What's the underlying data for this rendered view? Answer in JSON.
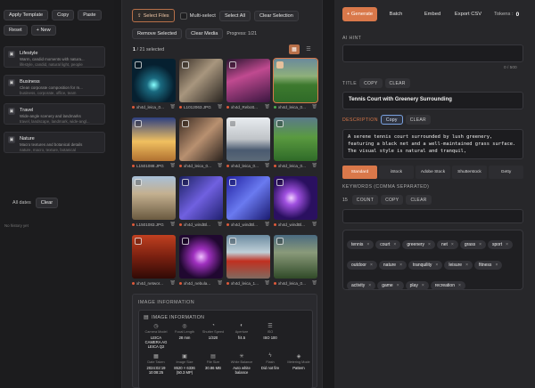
{
  "left": {
    "buttons": [
      "Apply Template",
      "Copy",
      "Paste"
    ],
    "row2": [
      "Reset",
      "+ New"
    ],
    "templates": [
      {
        "icon": "▣",
        "title": "Lifestyle",
        "sub": "Warm, candid moments with natura...",
        "tags": "lifestyle, candid, natural light, people"
      },
      {
        "icon": "▣",
        "title": "Business",
        "sub": "Clean corporate composition for m...",
        "tags": "business, corporate, office, team"
      },
      {
        "icon": "▣",
        "title": "Travel",
        "sub": "Wide-angle scenery and landmarks",
        "tags": "travel, landscape, landmark, wide-angl..."
      },
      {
        "icon": "▣",
        "title": "Nature",
        "sub": "Macro textures and botanical details",
        "tags": "nature, macro, texture, botanical"
      }
    ],
    "history_select": "All dates",
    "history_clear": "Clear",
    "no_history": "No history yet"
  },
  "middle": {
    "select_files": "Select Files",
    "multi_select": "Multi-select",
    "select_all": "Select All",
    "clear_selection": "Clear Selection",
    "remove_selected": "Remove Selected",
    "clear_media": "Clear Media",
    "progress": "Progress: 1/21",
    "count_current": "1",
    "count_rest": " / 21 selected",
    "images": [
      {
        "name": "xh4d_leica_0...",
        "dot": "#e05a3a"
      },
      {
        "name": "L1012063.JPG",
        "dot": "#e05a3a"
      },
      {
        "name": "xh4d_Rebott...",
        "dot": "#e05a3a"
      },
      {
        "name": "xh4d_leica_0...",
        "dot": "#4caf50"
      },
      {
        "name": "L1501088.JPG",
        "dot": "#e05a3a"
      },
      {
        "name": "xh4d_leica_0...",
        "dot": "#e05a3a"
      },
      {
        "name": "xh4d_leica_0...",
        "dot": "#e05a3a"
      },
      {
        "name": "xh4d_leica_0...",
        "dot": "#e05a3a"
      },
      {
        "name": "L1501083.JPG",
        "dot": "#e05a3a"
      },
      {
        "name": "xh4d_windBl...",
        "dot": "#e05a3a"
      },
      {
        "name": "xh4d_windBl...",
        "dot": "#e05a3a"
      },
      {
        "name": "xh4d_windBl...",
        "dot": "#e05a3a"
      },
      {
        "name": "xh4d_networ...",
        "dot": "#e05a3a"
      },
      {
        "name": "xh4d_nebula...",
        "dot": "#e05a3a"
      },
      {
        "name": "xh4d_leica_1...",
        "dot": "#e05a3a"
      },
      {
        "name": "xh4d_leica_0...",
        "dot": "#e05a3a"
      }
    ],
    "info_title": "IMAGE INFORMATION",
    "info_sub": "IMAGE INFORMATION",
    "meta": [
      {
        "icon": "◷",
        "label": "Camera Model",
        "value": "LEICA CAMERA AG LEICA Q2"
      },
      {
        "icon": "◎",
        "label": "Focal Length",
        "value": "28 mm"
      },
      {
        "icon": "◔",
        "label": "Shutter Speed",
        "value": "1/320"
      },
      {
        "icon": "◐",
        "label": "Aperture",
        "value": "f/4.5"
      },
      {
        "icon": "☰",
        "label": "ISO",
        "value": "ISO 100"
      },
      {
        "icon": "▦",
        "label": "Date Taken",
        "value": "2024:02:19 10:08:25"
      },
      {
        "icon": "▣",
        "label": "Image Size",
        "value": "8520 × 6336 (50.3 MP)"
      },
      {
        "icon": "▤",
        "label": "File Size",
        "value": "30.86 MB"
      },
      {
        "icon": "✳",
        "label": "White Balance",
        "value": "Auto white balance"
      },
      {
        "icon": "ϟ",
        "label": "Flash",
        "value": "Did not fire"
      },
      {
        "icon": "◈",
        "label": "Metering Mode",
        "value": "Pattern"
      }
    ]
  },
  "right": {
    "tabs": [
      "+ Generate",
      "Batch",
      "Embed",
      "Export CSV"
    ],
    "tokens_label": "Tokens :",
    "tokens_value": "0",
    "ai_hint": "AI HINT",
    "ai_counter": "0 / 500",
    "title_label": "TITLE",
    "copy": "COPY",
    "clear": "CLEAR",
    "title_value": "Tennis Court with Greenery Surrounding",
    "desc_label": "DESCRIPTION",
    "copy_d": "Copy",
    "clear_d": "CLEAR",
    "description": "A serene tennis court surrounded by lush greenery, featuring a black net and a well-maintained grass surface. The visual style is natural and tranquil,",
    "styles": [
      "Standard",
      "iStock",
      "Adobe Stock",
      "Shutterstock",
      "Getty"
    ],
    "kw_label": "KEYWORDS (COMMA SEPARATED)",
    "kw_count_n": "15",
    "kw_count": "COUNT",
    "kw_copy": "COPY",
    "kw_clear": "CLEAR",
    "keywords": [
      "tennis",
      "court",
      "greenery",
      "net",
      "grass",
      "sport",
      "outdoor",
      "nature",
      "tranquility",
      "leisure",
      "fitness",
      "activity",
      "game",
      "play",
      "recreation"
    ]
  },
  "colors": {
    "accent": "#d9784a",
    "panel": "#27272a",
    "bg": "#1b1b1d"
  }
}
